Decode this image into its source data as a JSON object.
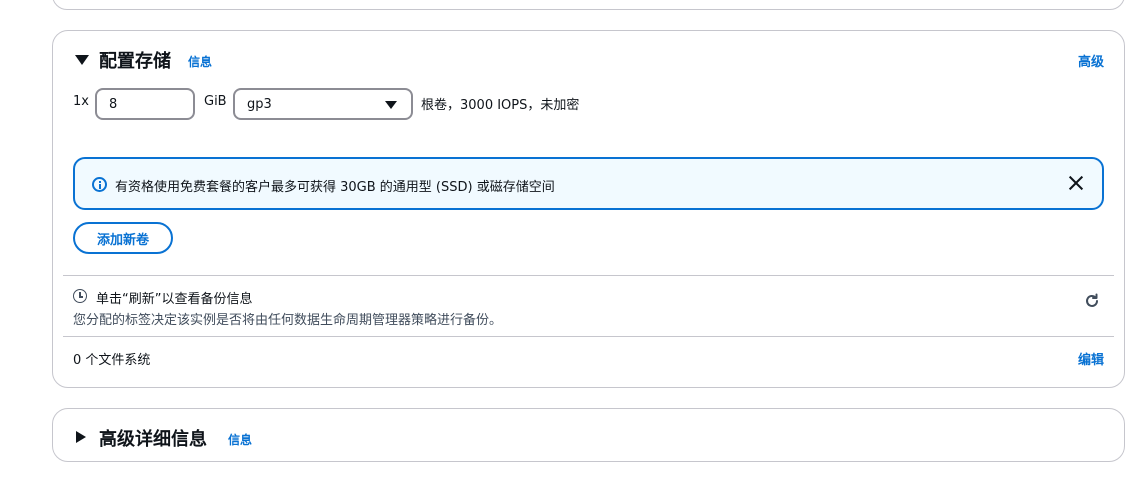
{
  "storage": {
    "title": "配置存储",
    "info_link": "信息",
    "advanced_link": "高级",
    "volume": {
      "multiplier": "1x",
      "size_value": "8",
      "unit": "GiB",
      "type_value": "gp3",
      "description": "根卷，3000 IOPS，未加密"
    },
    "alert": {
      "text": "有资格使用免费套餐的客户最多可获得 30GB 的通用型 (SSD) 或磁存储空间"
    },
    "add_volume_button": "添加新卷",
    "backup": {
      "title": "单击“刷新”以查看备份信息",
      "description": "您分配的标签决定该实例是否将由任何数据生命周期管理器策略进行备份。"
    },
    "file_systems": {
      "label": "0 个文件系统",
      "edit_link": "编辑"
    }
  },
  "advanced_details": {
    "title": "高级详细信息",
    "info_link": "信息"
  },
  "colors": {
    "link": "#0972d3",
    "alert_bg": "#f1faff",
    "border": "#c6c6cd"
  }
}
